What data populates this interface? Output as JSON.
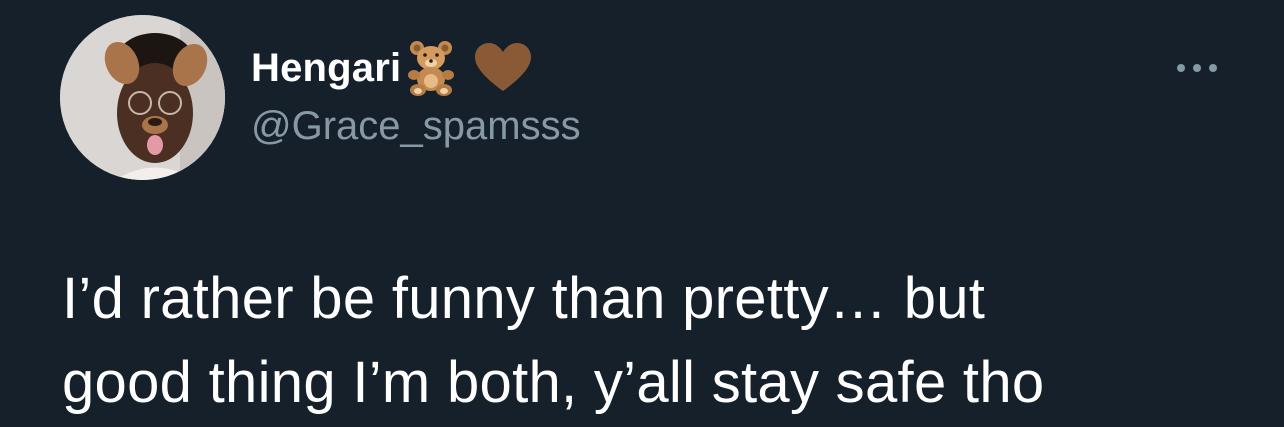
{
  "tweet": {
    "author": {
      "display_name": "Hengari",
      "handle": "@Grace_spamsss",
      "name_emojis": [
        "teddy-bear-icon",
        "brown-heart-icon"
      ]
    },
    "text": "I’d rather be funny than pretty… but\ngood thing I’m both, y’all stay safe tho",
    "more_icon": "more-horizontal-icon"
  },
  "colors": {
    "background": "#15202b",
    "primary_text": "#ffffff",
    "secondary_text": "#8899a6",
    "heart": "#8a5a36"
  }
}
